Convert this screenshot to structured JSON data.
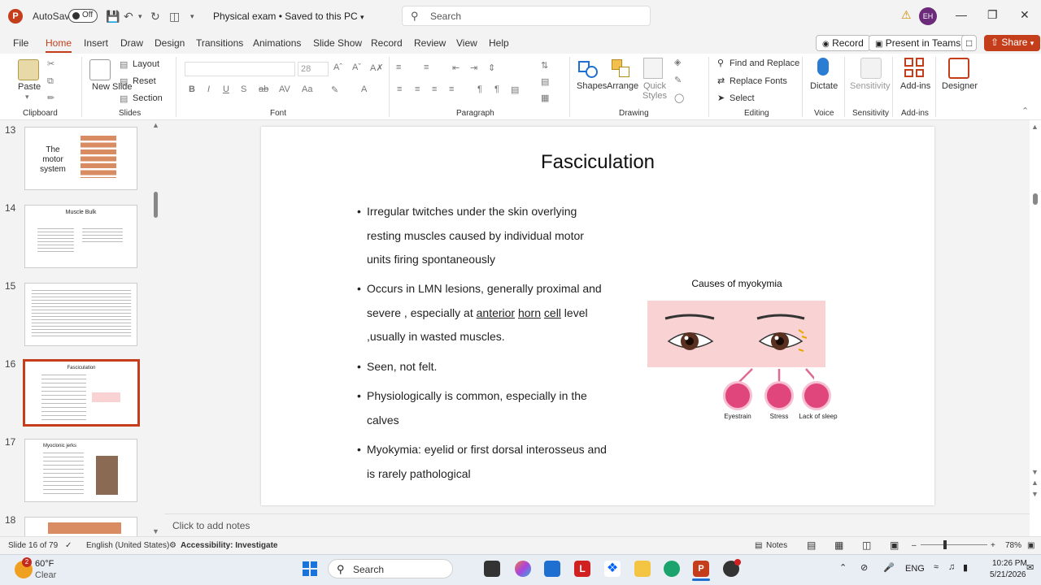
{
  "titlebar": {
    "logo": "P",
    "autosave_label": "AutoSave",
    "autosave_state": "Off",
    "doc_title": "Physical exam • Saved to this PC",
    "search_placeholder": "Search",
    "user_initials": "EH"
  },
  "menu": {
    "items": [
      "File",
      "Home",
      "Insert",
      "Draw",
      "Design",
      "Transitions",
      "Animations",
      "Slide Show",
      "Record",
      "Review",
      "View",
      "Help"
    ],
    "active": "Home",
    "record_btn": "Record",
    "teams_btn": "Present in Teams",
    "share_btn": "Share"
  },
  "ribbon": {
    "clipboard": {
      "paste": "Paste",
      "group": "Clipboard"
    },
    "slides": {
      "new_slide": "New Slide",
      "layout": "Layout",
      "reset": "Reset",
      "section": "Section",
      "group": "Slides"
    },
    "font": {
      "size": "28",
      "group": "Font"
    },
    "paragraph": {
      "group": "Paragraph"
    },
    "drawing": {
      "shapes": "Shapes",
      "arrange": "Arrange",
      "quick_styles": "Quick Styles",
      "group": "Drawing"
    },
    "editing": {
      "find_replace": "Find and Replace",
      "replace_fonts": "Replace Fonts",
      "select": "Select",
      "group": "Editing"
    },
    "voice": {
      "dictate": "Dictate",
      "group": "Voice"
    },
    "sensitivity": {
      "label": "Sensitivity",
      "group": "Sensitivity"
    },
    "addins": {
      "label": "Add-ins",
      "group": "Add-ins"
    },
    "designer": {
      "label": "Designer"
    }
  },
  "thumbnails": [
    {
      "num": "13",
      "title": "The motor system"
    },
    {
      "num": "14",
      "title": "Muscle Bulk"
    },
    {
      "num": "15",
      "title": ""
    },
    {
      "num": "16",
      "title": "Fasciculation"
    },
    {
      "num": "17",
      "title": "Myoclonic jerks"
    },
    {
      "num": "18",
      "title": ""
    }
  ],
  "slide": {
    "title": "Fasciculation",
    "b1": "Irregular twitches under the skin overlying resting muscles caused by individual motor units firing spontaneously",
    "b2_pre": "Occurs in LMN lesions, generally proximal and severe , especially at ",
    "b2_u1": "anterior",
    "b2_u2": "horn",
    "b2_u3": "cell",
    "b2_post": " level ,usually in wasted muscles.",
    "b3": "Seen, not felt.",
    "b4": "Physiologically is common, especially in the calves",
    "b5": "Myokymia: eyelid or first dorsal interosseus and is rarely pathological",
    "figure_title": "Causes of myokymia",
    "causes": [
      "Eyestrain",
      "Stress",
      "Lack of sleep"
    ]
  },
  "notes_placeholder": "Click to add notes",
  "status": {
    "slide_counter": "Slide 16 of 79",
    "language": "English (United States)",
    "accessibility": "Accessibility: Investigate",
    "notes": "Notes",
    "zoom": "78%"
  },
  "taskbar": {
    "weather_temp": "60°F",
    "weather_desc": "Clear",
    "weather_badge": "2",
    "search": "Search",
    "lang": "ENG",
    "time": "10:26 PM",
    "date": "5/21/2026"
  },
  "colors": {
    "accent": "#c43e1c",
    "figure_bg": "#f9d3d3",
    "cause_icon": "#e0457b"
  }
}
